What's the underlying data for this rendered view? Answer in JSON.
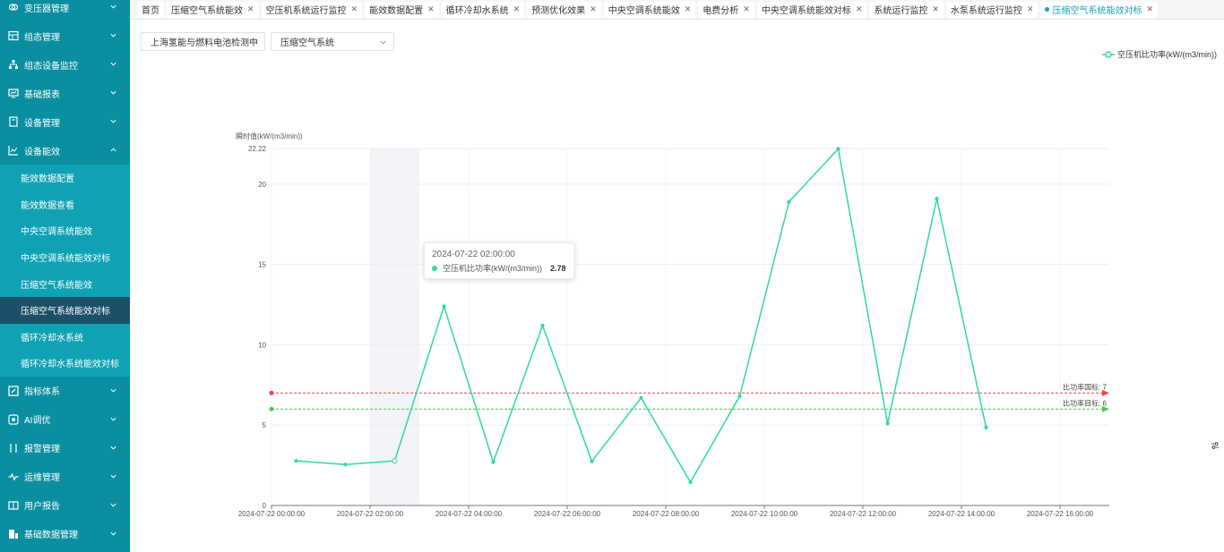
{
  "sidebar": {
    "items": [
      {
        "label": "变压器管理",
        "icon": "transformer-icon",
        "expanded": false
      },
      {
        "label": "组态管理",
        "icon": "grid-icon",
        "expanded": false
      },
      {
        "label": "组态设备监控",
        "icon": "sitemap-icon",
        "expanded": false
      },
      {
        "label": "基础报表",
        "icon": "report-icon",
        "expanded": false
      },
      {
        "label": "设备管理",
        "icon": "device-icon",
        "expanded": false
      },
      {
        "label": "设备能效",
        "icon": "chart-icon",
        "expanded": true
      }
    ],
    "sub_items": [
      {
        "label": "能效数据配置",
        "active": false
      },
      {
        "label": "能效数据查看",
        "active": false
      },
      {
        "label": "中央空调系统能效",
        "active": false
      },
      {
        "label": "中央空调系统能效对标",
        "active": false
      },
      {
        "label": "压缩空气系统能效",
        "active": false
      },
      {
        "label": "压缩空气系统能效对标",
        "active": true
      },
      {
        "label": "循环冷却水系统",
        "active": false
      },
      {
        "label": "循环冷却水系统能效对标",
        "active": false
      }
    ],
    "items_after": [
      {
        "label": "指标体系",
        "icon": "edit-icon"
      },
      {
        "label": "AI调优",
        "icon": "ai-icon"
      },
      {
        "label": "报警管理",
        "icon": "alarm-icon"
      },
      {
        "label": "运维管理",
        "icon": "pulse-icon"
      },
      {
        "label": "用户报告",
        "icon": "book-icon"
      },
      {
        "label": "基础数据管理",
        "icon": "database-icon"
      }
    ]
  },
  "tabs": [
    {
      "label": "首页",
      "closable": false,
      "active": false
    },
    {
      "label": "压缩空气系统能效",
      "closable": true,
      "active": false
    },
    {
      "label": "空压机系统运行监控",
      "closable": true,
      "active": false
    },
    {
      "label": "能效数据配置",
      "closable": true,
      "active": false
    },
    {
      "label": "循环冷却水系统",
      "closable": true,
      "active": false
    },
    {
      "label": "预测优化效果",
      "closable": true,
      "active": false
    },
    {
      "label": "中央空调系统能效",
      "closable": true,
      "active": false
    },
    {
      "label": "电费分析",
      "closable": true,
      "active": false
    },
    {
      "label": "中央空调系统能效对标",
      "closable": true,
      "active": false
    },
    {
      "label": "系统运行监控",
      "closable": true,
      "active": false
    },
    {
      "label": "水泵系统运行监控",
      "closable": true,
      "active": false
    },
    {
      "label": "压缩空气系统能效对标",
      "closable": true,
      "active": true
    }
  ],
  "filters": {
    "site": "上海氢能与燃料电池检测中",
    "system": "压缩空气系统"
  },
  "colors": {
    "sidebar_bg": "#0a8ea0",
    "series": "#2ed9a3",
    "national_line": "#ee4444",
    "target_line": "#44cc44",
    "hover_band": "#f2f4f8"
  },
  "tooltip": {
    "time": "2024-07-22 02:00:00",
    "series": "空压机比功率(kW/(m3/min))",
    "value": "2.78"
  },
  "chart_data": {
    "type": "line",
    "ylabel": "瞬时值(kW/(m3/min))",
    "ylim": [
      0,
      22.22
    ],
    "yticks": [
      0,
      5,
      10,
      15,
      20,
      22.22
    ],
    "ytick_labels": [
      "0",
      "5",
      "10",
      "15",
      "20",
      "22.22"
    ],
    "xtick_labels": [
      "2024-07-22 00:00:00",
      "2024-07-22 02:00:00",
      "2024-07-22 04:00:00",
      "2024-07-22 06:00:00",
      "2024-07-22 08:00:00",
      "2024-07-22 10:00:00",
      "2024-07-22 12:00:00",
      "2024-07-22 14:00:00",
      "2024-07-22 16:00:00"
    ],
    "x_unit": "hours",
    "xlim": [
      0,
      17
    ],
    "grid": true,
    "legend_position": "top-right",
    "series": [
      {
        "name": "空压机比功率(kW/(m3/min))",
        "x": [
          0.5,
          1.5,
          2.5,
          3.5,
          4.5,
          5.5,
          6.5,
          7.5,
          8.5,
          9.5,
          10.5,
          11.5,
          12.5,
          13.5,
          14.5
        ],
        "values": [
          2.78,
          2.55,
          2.78,
          12.4,
          2.7,
          11.2,
          2.75,
          6.7,
          1.45,
          6.8,
          18.9,
          22.2,
          5.1,
          19.1,
          4.85
        ]
      }
    ],
    "reference_lines": [
      {
        "label": "比功率国标: 7",
        "value": 7,
        "color": "#ee4444"
      },
      {
        "label": "比功率目标: 6",
        "value": 6,
        "color": "#44cc44"
      }
    ],
    "highlight_x": 2.5
  }
}
